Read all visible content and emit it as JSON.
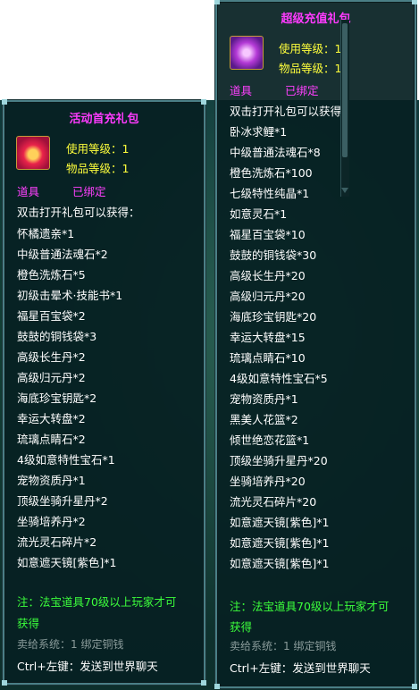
{
  "left_tooltip": {
    "title": "活动首充礼包",
    "use_level": "使用等级：1",
    "item_level": "物品等级：1",
    "category": "道具",
    "bind": "已绑定",
    "intro": "双击打开礼包可以获得：",
    "items": [
      "怀橘遗亲*1",
      "中级普通法魂石*2",
      "橙色洗炼石*5",
      "初级击晕术·技能书*1",
      "福星百宝袋*2",
      "鼓鼓的铜钱袋*3",
      "高级长生丹*2",
      "高级归元丹*2",
      "海底珍宝钥匙*2",
      "幸运大转盘*2",
      "琉璃点睛石*2",
      "4级如意特性宝石*1",
      "宠物资质丹*1",
      "顶级坐骑升星丹*2",
      "坐骑培养丹*2",
      "流光灵石碎片*2",
      "如意遮天镜[紫色]*1"
    ],
    "note_line1": "注：法宝道具70级以上玩家才可",
    "note_line2": "获得",
    "sell": "卖给系统：1 绑定铜钱",
    "hint": "Ctrl+左键：发送到世界聊天"
  },
  "right_tooltip": {
    "title": "超级充值礼包",
    "use_level": "使用等级：1",
    "item_level": "物品等级：1",
    "category": "道具",
    "bind": "已绑定",
    "intro": "双击打开礼包可以获得：",
    "items": [
      "卧冰求鲤*1",
      "中级普通法魂石*8",
      "橙色洗炼石*100",
      "七级特性纯晶*1",
      "如意灵石*1",
      "福星百宝袋*10",
      "鼓鼓的铜钱袋*30",
      "高级长生丹*20",
      "高级归元丹*20",
      "海底珍宝钥匙*20",
      "幸运大转盘*15",
      "琉璃点睛石*10",
      "4级如意特性宝石*5",
      "宠物资质丹*1",
      "黑美人花篮*2",
      "倾世绝恋花篮*1",
      "顶级坐骑升星丹*20",
      "坐骑培养丹*20",
      "流光灵石碎片*20",
      "如意遮天镜[紫色]*1",
      "如意遮天镜[紫色]*1",
      "如意遮天镜[紫色]*1"
    ],
    "note_line1": "注：法宝道具70级以上玩家才可",
    "note_line2": "获得",
    "sell": "卖给系统：1 绑定铜钱",
    "hint": "Ctrl+左键：发送到世界聊天"
  },
  "colors": {
    "title": "#ff3bff",
    "level": "#ffff3c",
    "category": "#ff40ff",
    "note": "#3cff3c",
    "sell": "#8a9b9a",
    "text": "#ffffff"
  },
  "icons": {
    "left": "red-gift-box-icon",
    "right": "purple-gift-box-icon"
  }
}
